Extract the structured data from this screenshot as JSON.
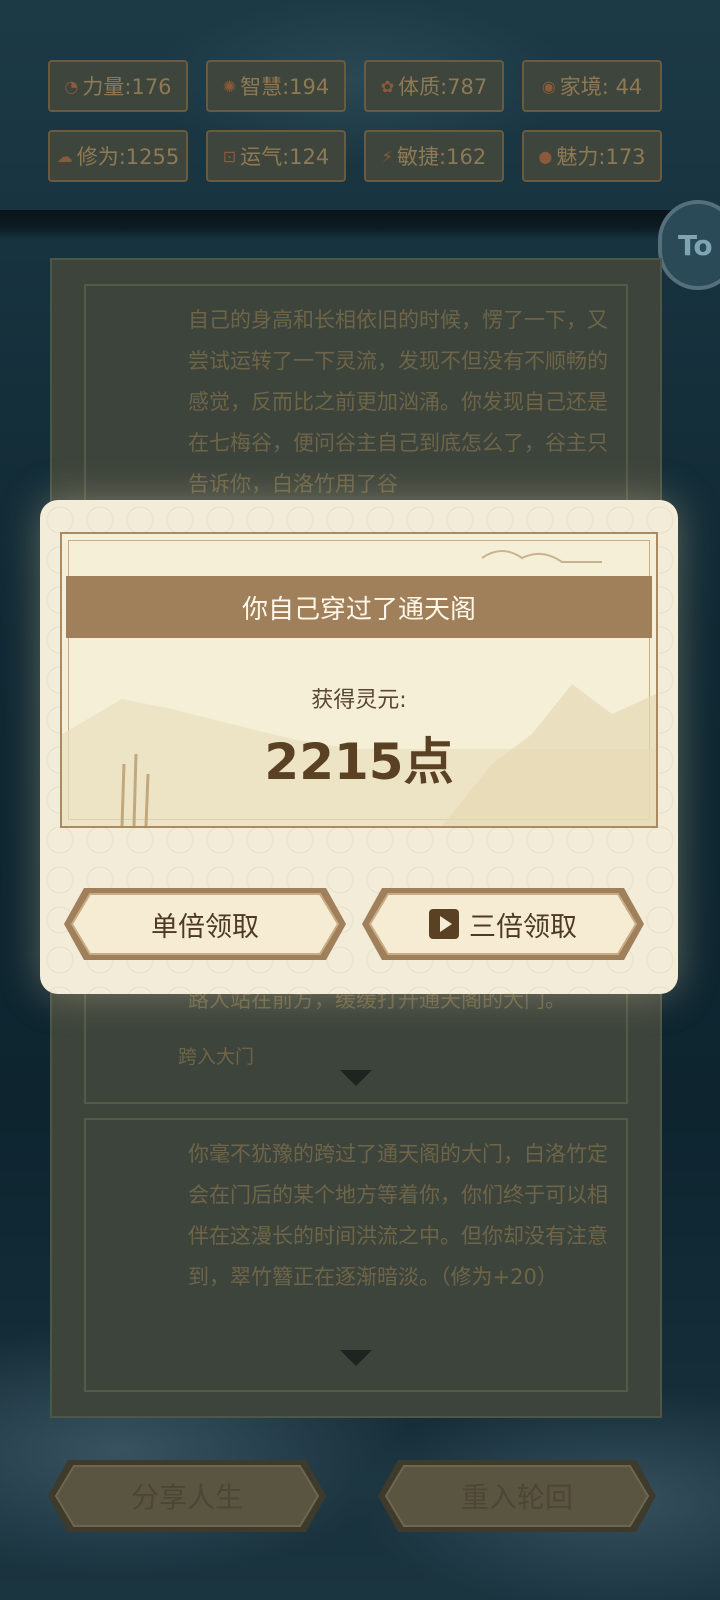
{
  "stats": [
    {
      "icon": "strength-icon",
      "glyph": "◔",
      "label": "力量:176"
    },
    {
      "icon": "wisdom-icon",
      "glyph": "✺",
      "label": "智慧:194"
    },
    {
      "icon": "constitution-icon",
      "glyph": "✿",
      "label": "体质:787"
    },
    {
      "icon": "family-icon",
      "glyph": "◉",
      "label": "家境: 44"
    },
    {
      "icon": "cultivation-icon",
      "glyph": "☁",
      "label": "修为:1255"
    },
    {
      "icon": "luck-icon",
      "glyph": "⊡",
      "label": "运气:124"
    },
    {
      "icon": "agility-icon",
      "glyph": "⚡",
      "label": "敏捷:162"
    },
    {
      "icon": "charm-icon",
      "glyph": "●",
      "label": "魅力:173"
    }
  ],
  "badge": {
    "text": "To"
  },
  "story": {
    "paragraph1": "自己的身高和长相依旧的时候，愣了一下，又尝试运转了一下灵流，发现不但没有不顺畅的感觉，反而比之前更加汹涌。你发现自己还是在七梅谷，便问谷主自己到底怎么了，谷主只告诉你，白洛竹用了谷",
    "paragraph2": "路人站在前方，缓缓打开通天阁的大门。",
    "choice": "跨入大门",
    "paragraph3": "你毫不犹豫的跨过了通天阁的大门，白洛竹定会在门后的某个地方等着你，你们终于可以相伴在这漫长的时间洪流之中。但你却没有注意到，翠竹簪正在逐渐暗淡。（修为+20）"
  },
  "modal": {
    "title": "你自己穿过了通天阁",
    "reward_label": "获得灵元:",
    "reward_value": "2215点",
    "single_button": "单倍领取",
    "triple_button": "三倍领取"
  },
  "bottom": {
    "share_button": "分享人生",
    "restart_button": "重入轮回"
  },
  "colors": {
    "accent": "#a07f5b",
    "panel": "#f2ecd9",
    "text_dark": "#5a4124"
  }
}
